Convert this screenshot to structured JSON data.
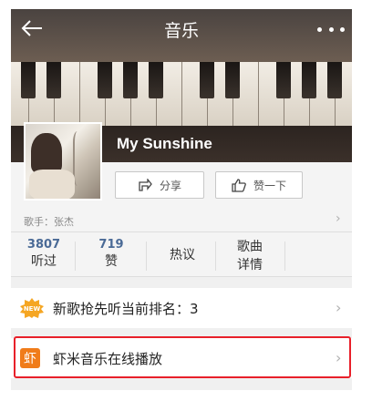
{
  "header": {
    "title": "音乐"
  },
  "song": {
    "title": "My Sunshine",
    "singer": "歌手：张杰"
  },
  "actions": {
    "share_label": "分享",
    "like_label": "赞一下"
  },
  "stats": [
    {
      "num": "3807",
      "label": "听过"
    },
    {
      "num": "719",
      "label": "赞"
    },
    {
      "num": "",
      "label": "热议"
    },
    {
      "num": "",
      "label": "歌曲详情"
    }
  ],
  "stats_detail_lines": [
    "歌曲",
    "详情"
  ],
  "rows": {
    "newsong": {
      "badge": "NEW",
      "label": "新歌抢先听当前排名：3"
    },
    "xiami": {
      "badge_char": "虾",
      "label": "虾米音乐在线播放"
    }
  },
  "colors": {
    "accent_blue": "#4a6a96",
    "highlight_red": "#e8202a",
    "new_badge": "#f5a623",
    "xiami_orange": "#f07c1a"
  }
}
